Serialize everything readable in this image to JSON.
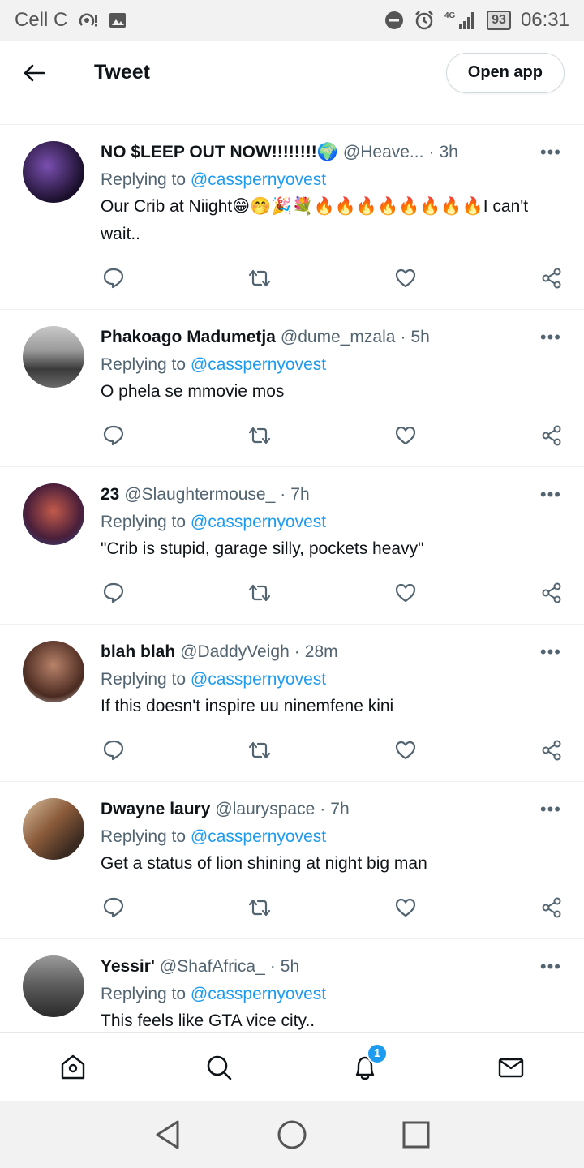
{
  "status_bar": {
    "carrier": "Cell C",
    "network": "4G",
    "battery": "93",
    "time": "06:31"
  },
  "header": {
    "title": "Tweet",
    "open_app_label": "Open app"
  },
  "reply_prefix": "Replying to",
  "tweets": [
    {
      "name": "NO $LEEP OUT NOW!!!!!!!!🌍",
      "handle": "@Heave...",
      "time": "3h",
      "mention": "@casspernyovest",
      "text": "Our Crib at Niight😁🤭🎉💐🔥🔥🔥🔥🔥🔥🔥🔥I can't wait..",
      "avatar_color": "#2b1a44"
    },
    {
      "name": "Phakoago Madumetja",
      "handle": "@dume_mzala",
      "time": "5h",
      "mention": "@casspernyovest",
      "text": "O phela se mmovie mos",
      "avatar_color": "#5a5a5a"
    },
    {
      "name": "23",
      "handle": "@Slaughtermouse_",
      "time": "7h",
      "mention": "@casspernyovest",
      "text": "\"Crib is stupid, garage silly, pockets heavy\"",
      "avatar_color": "#7a2a3a"
    },
    {
      "name": "blah blah",
      "handle": "@DaddyVeigh",
      "time": "28m",
      "mention": "@casspernyovest",
      "text": "If this doesn't inspire uu ninemfene kini",
      "avatar_color": "#6b4a3a"
    },
    {
      "name": "Dwayne laury",
      "handle": "@lauryspace",
      "time": "7h",
      "mention": "@casspernyovest",
      "text": "Get a status of lion shining at night big man",
      "avatar_color": "#8a6a4a"
    },
    {
      "name": "Yessir'",
      "handle": "@ShafAfrica_",
      "time": "5h",
      "mention": "@casspernyovest",
      "text": "This feels like GTA vice city..",
      "avatar_color": "#4a4a4a"
    }
  ],
  "bottom_nav": {
    "notifications_badge": "1"
  },
  "colors": {
    "accent": "#1d9bf0",
    "secondary_text": "#536471"
  }
}
